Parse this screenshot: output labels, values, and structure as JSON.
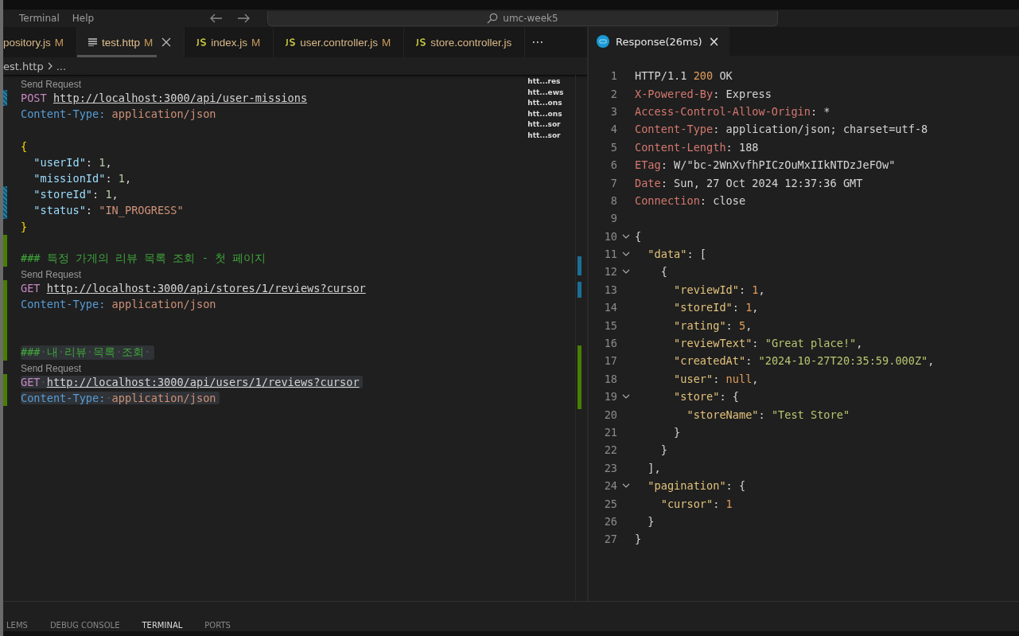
{
  "title_bar": {
    "menus": [
      "Terminal",
      "Help"
    ],
    "search": "umc-week5"
  },
  "editor_tabs": [
    {
      "label": "pository.js",
      "badge": "M",
      "kind": "plain",
      "selected": false
    },
    {
      "label": "test.http",
      "badge": "M",
      "kind": "http",
      "selected": true
    },
    {
      "label": "index.js",
      "badge": "M",
      "kind": "js",
      "selected": false
    },
    {
      "label": "user.controller.js",
      "badge": "M",
      "kind": "js",
      "selected": false
    },
    {
      "label": "store.controller.js",
      "kind": "js",
      "selected": false
    }
  ],
  "tab_more": "···",
  "breadcrumb": [
    "est.http",
    "..."
  ],
  "editor_lines": [
    {
      "kind": "codelens",
      "text": "Send Request"
    },
    {
      "kind": "code",
      "modified": true,
      "added": false,
      "highlighted": false,
      "tokens": [
        {
          "t": "POST ",
          "kind": "method"
        },
        {
          "t": "http://localhost:3000/api/user-missions",
          "kind": "url"
        }
      ]
    },
    {
      "kind": "code",
      "modified": false,
      "added": false,
      "highlighted": false,
      "tokens": [
        {
          "t": "Content-Type:",
          "kind": "header"
        },
        {
          "t": " application/json",
          "kind": "value"
        }
      ]
    },
    {
      "kind": "blank",
      "modified": false,
      "added": false
    },
    {
      "kind": "code",
      "modified": false,
      "added": false,
      "highlighted": false,
      "tokens": [
        {
          "t": "{",
          "kind": "brace"
        }
      ]
    },
    {
      "kind": "code",
      "modified": false,
      "added": false,
      "highlighted": false,
      "tokens": [
        {
          "t": "  \"userId\"",
          "kind": "key"
        },
        {
          "t": ": ",
          "kind": "plain"
        },
        {
          "t": "1",
          "kind": "number"
        },
        {
          "t": ",",
          "kind": "plain"
        }
      ]
    },
    {
      "kind": "code",
      "modified": false,
      "added": false,
      "highlighted": false,
      "tokens": [
        {
          "t": "  \"missionId\"",
          "kind": "key"
        },
        {
          "t": ": ",
          "kind": "plain"
        },
        {
          "t": "1",
          "kind": "number"
        },
        {
          "t": ",",
          "kind": "plain"
        }
      ]
    },
    {
      "kind": "code",
      "modified": true,
      "added": false,
      "highlighted": false,
      "tokens": [
        {
          "t": "  \"storeId\"",
          "kind": "key"
        },
        {
          "t": ": ",
          "kind": "plain"
        },
        {
          "t": "1",
          "kind": "number"
        },
        {
          "t": ",",
          "kind": "plain"
        }
      ]
    },
    {
      "kind": "code",
      "modified": true,
      "added": false,
      "highlighted": false,
      "tokens": [
        {
          "t": "  \"status\"",
          "kind": "key"
        },
        {
          "t": ": ",
          "kind": "plain"
        },
        {
          "t": "\"IN_PROGRESS\"",
          "kind": "value"
        }
      ]
    },
    {
      "kind": "code",
      "modified": false,
      "added": false,
      "highlighted": false,
      "tokens": [
        {
          "t": "}",
          "kind": "brace"
        }
      ]
    },
    {
      "kind": "blank",
      "modified": false,
      "added": true
    },
    {
      "kind": "code",
      "modified": false,
      "added": true,
      "highlighted": false,
      "tokens": [
        {
          "t": "### 특정 가게의 리뷰 목록 조회 - 첫 페이지",
          "kind": "comment"
        }
      ]
    },
    {
      "kind": "codelens",
      "text": "Send Request"
    },
    {
      "kind": "code",
      "modified": false,
      "added": true,
      "highlighted": false,
      "tokens": [
        {
          "t": "GET ",
          "kind": "method"
        },
        {
          "t": "http://localhost:3000/api/stores/1/reviews?cursor",
          "kind": "url"
        }
      ]
    },
    {
      "kind": "code",
      "modified": false,
      "added": true,
      "highlighted": false,
      "tokens": [
        {
          "t": "Content-Type:",
          "kind": "header"
        },
        {
          "t": " application/json",
          "kind": "value"
        }
      ]
    },
    {
      "kind": "blank",
      "modified": false,
      "added": true
    },
    {
      "kind": "blank",
      "modified": false,
      "added": true
    },
    {
      "kind": "code",
      "modified": false,
      "added": true,
      "highlighted": true,
      "tokens": [
        {
          "t": "###",
          "kind": "comment"
        },
        {
          "t": "·",
          "kind": "ws"
        },
        {
          "t": "내",
          "kind": "comment"
        },
        {
          "t": "·",
          "kind": "ws"
        },
        {
          "t": "리뷰",
          "kind": "comment"
        },
        {
          "t": "·",
          "kind": "ws"
        },
        {
          "t": "목록",
          "kind": "comment"
        },
        {
          "t": "·",
          "kind": "ws"
        },
        {
          "t": "조회",
          "kind": "comment"
        },
        {
          "t": "·",
          "kind": "ws"
        }
      ]
    },
    {
      "kind": "codelens",
      "text": "Send Request"
    },
    {
      "kind": "code",
      "modified": false,
      "added": true,
      "highlighted": true,
      "tokens": [
        {
          "t": "GET",
          "kind": "method"
        },
        {
          "t": "·",
          "kind": "ws"
        },
        {
          "t": "http://localhost:3000/api/users/1/reviews?cursor",
          "kind": "url"
        }
      ]
    },
    {
      "kind": "code",
      "modified": false,
      "added": true,
      "highlighted": true,
      "tokens": [
        {
          "t": "Content-Type:",
          "kind": "header"
        },
        {
          "t": "·",
          "kind": "ws"
        },
        {
          "t": "application/json",
          "kind": "value"
        }
      ]
    }
  ],
  "minimap_labels": [
    "htt...res",
    "htt...ews",
    "htt...ons",
    "htt...ons",
    "htt...sor",
    "htt...sor"
  ],
  "response_tab": {
    "label": "Response(26ms)",
    "close": "×",
    "selected": true
  },
  "response_lines": [
    {
      "num": "1",
      "fold": false,
      "tokens": [
        {
          "t": "HTTP/1.1 ",
          "kind": "plain"
        },
        {
          "t": "200",
          "kind": "status"
        },
        {
          "t": " OK",
          "kind": "plain"
        }
      ]
    },
    {
      "num": "2",
      "fold": false,
      "tokens": [
        {
          "t": "X-Powered-By",
          "kind": "rheader"
        },
        {
          "t": ": Express",
          "kind": "plain"
        }
      ]
    },
    {
      "num": "3",
      "fold": false,
      "tokens": [
        {
          "t": "Access-Control-Allow-Origin",
          "kind": "rheader"
        },
        {
          "t": ": *",
          "kind": "plain"
        }
      ]
    },
    {
      "num": "4",
      "fold": false,
      "tokens": [
        {
          "t": "Content-Type",
          "kind": "rheader"
        },
        {
          "t": ": application/json; charset=utf-8",
          "kind": "plain"
        }
      ]
    },
    {
      "num": "5",
      "fold": false,
      "tokens": [
        {
          "t": "Content-Length",
          "kind": "rheader"
        },
        {
          "t": ": 188",
          "kind": "plain"
        }
      ]
    },
    {
      "num": "6",
      "fold": false,
      "tokens": [
        {
          "t": "ETag",
          "kind": "rheader"
        },
        {
          "t": ": W/\"bc-2WnXvfhPICzOuMxIIkNTDzJeFOw\"",
          "kind": "plain"
        }
      ]
    },
    {
      "num": "7",
      "fold": false,
      "tokens": [
        {
          "t": "Date",
          "kind": "rheader"
        },
        {
          "t": ": Sun, 27 Oct 2024 12:37:36 GMT",
          "kind": "plain"
        }
      ]
    },
    {
      "num": "8",
      "fold": false,
      "tokens": [
        {
          "t": "Connection",
          "kind": "rheader"
        },
        {
          "t": ": close",
          "kind": "plain"
        }
      ]
    },
    {
      "num": "9",
      "fold": false
    },
    {
      "num": "10",
      "fold": true,
      "tokens": [
        {
          "t": "{",
          "kind": "plain"
        }
      ]
    },
    {
      "num": "11",
      "fold": true,
      "tokens": [
        {
          "t": "  \"data\"",
          "kind": "jkey"
        },
        {
          "t": ": [",
          "kind": "plain"
        }
      ]
    },
    {
      "num": "12",
      "fold": true,
      "tokens": [
        {
          "t": "    {",
          "kind": "plain"
        }
      ]
    },
    {
      "num": "13",
      "fold": false,
      "tokens": [
        {
          "t": "      \"reviewId\"",
          "kind": "jkey"
        },
        {
          "t": ": ",
          "kind": "plain"
        },
        {
          "t": "1",
          "kind": "jnum"
        },
        {
          "t": ",",
          "kind": "plain"
        }
      ]
    },
    {
      "num": "14",
      "fold": false,
      "tokens": [
        {
          "t": "      \"storeId\"",
          "kind": "jkey"
        },
        {
          "t": ": ",
          "kind": "plain"
        },
        {
          "t": "1",
          "kind": "jnum"
        },
        {
          "t": ",",
          "kind": "plain"
        }
      ]
    },
    {
      "num": "15",
      "fold": false,
      "tokens": [
        {
          "t": "      \"rating\"",
          "kind": "jkey"
        },
        {
          "t": ": ",
          "kind": "plain"
        },
        {
          "t": "5",
          "kind": "jnum"
        },
        {
          "t": ",",
          "kind": "plain"
        }
      ]
    },
    {
      "num": "16",
      "fold": false,
      "tokens": [
        {
          "t": "      \"reviewText\"",
          "kind": "jkey"
        },
        {
          "t": ": ",
          "kind": "plain"
        },
        {
          "t": "\"Great place!\"",
          "kind": "jstr"
        },
        {
          "t": ",",
          "kind": "plain"
        }
      ]
    },
    {
      "num": "17",
      "fold": false,
      "tokens": [
        {
          "t": "      \"createdAt\"",
          "kind": "jkey"
        },
        {
          "t": ": ",
          "kind": "plain"
        },
        {
          "t": "\"2024-10-27T20:35:59.000Z\"",
          "kind": "jstr"
        },
        {
          "t": ",",
          "kind": "plain"
        }
      ]
    },
    {
      "num": "18",
      "fold": false,
      "tokens": [
        {
          "t": "      \"user\"",
          "kind": "jkey"
        },
        {
          "t": ": ",
          "kind": "plain"
        },
        {
          "t": "null",
          "kind": "jnum"
        },
        {
          "t": ",",
          "kind": "plain"
        }
      ]
    },
    {
      "num": "19",
      "fold": true,
      "tokens": [
        {
          "t": "      \"store\"",
          "kind": "jkey"
        },
        {
          "t": ": {",
          "kind": "plain"
        }
      ]
    },
    {
      "num": "20",
      "fold": false,
      "tokens": [
        {
          "t": "        \"storeName\"",
          "kind": "jkey"
        },
        {
          "t": ": ",
          "kind": "plain"
        },
        {
          "t": "\"Test Store\"",
          "kind": "jstr"
        }
      ]
    },
    {
      "num": "21",
      "fold": false,
      "tokens": [
        {
          "t": "      }",
          "kind": "plain"
        }
      ]
    },
    {
      "num": "22",
      "fold": false,
      "tokens": [
        {
          "t": "    }",
          "kind": "plain"
        }
      ]
    },
    {
      "num": "23",
      "fold": false,
      "tokens": [
        {
          "t": "  ],",
          "kind": "plain"
        }
      ]
    },
    {
      "num": "24",
      "fold": true,
      "tokens": [
        {
          "t": "  \"pagination\"",
          "kind": "jkey"
        },
        {
          "t": ": {",
          "kind": "plain"
        }
      ]
    },
    {
      "num": "25",
      "fold": false,
      "tokens": [
        {
          "t": "    \"cursor\"",
          "kind": "jkey"
        },
        {
          "t": ": ",
          "kind": "plain"
        },
        {
          "t": "1",
          "kind": "jnum"
        }
      ]
    },
    {
      "num": "26",
      "fold": false,
      "tokens": [
        {
          "t": "  }",
          "kind": "plain"
        }
      ]
    },
    {
      "num": "27",
      "fold": false,
      "tokens": [
        {
          "t": "}",
          "kind": "plain"
        }
      ]
    }
  ],
  "panel_tabs": [
    {
      "label": "LEMS",
      "selected": false
    },
    {
      "label": "DEBUG CONSOLE",
      "selected": false
    },
    {
      "label": "TERMINAL",
      "selected": true
    },
    {
      "label": "PORTS",
      "selected": false
    }
  ]
}
